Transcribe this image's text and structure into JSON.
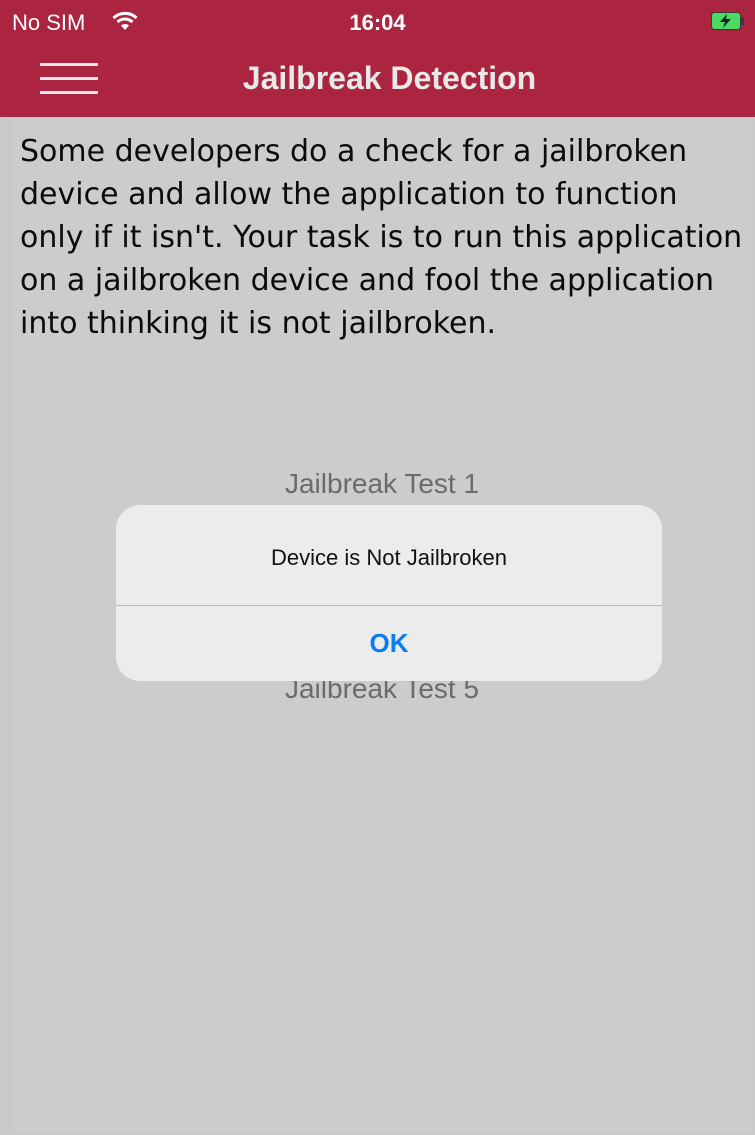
{
  "status_bar": {
    "carrier": "No SIM",
    "time": "16:04",
    "wifi_icon": "wifi-icon",
    "battery_icon": "battery-charging-icon"
  },
  "nav_bar": {
    "title": "Jailbreak Detection",
    "menu_icon": "hamburger-menu-icon"
  },
  "content": {
    "description": "Some developers do a check for a jailbroken device and allow the application to function only if it isn't. Your task is to run this application on a jailbroken device and fool the application into thinking it is not jailbroken.",
    "tests": [
      {
        "label": "Jailbreak Test 1"
      },
      {
        "label": "Jailbreak Test 5"
      }
    ]
  },
  "alert": {
    "message": "Device is Not Jailbroken",
    "ok_label": "OK"
  },
  "colors": {
    "header": "#ab2540",
    "background": "#cccccc",
    "alert_button": "#0a7cf4"
  }
}
